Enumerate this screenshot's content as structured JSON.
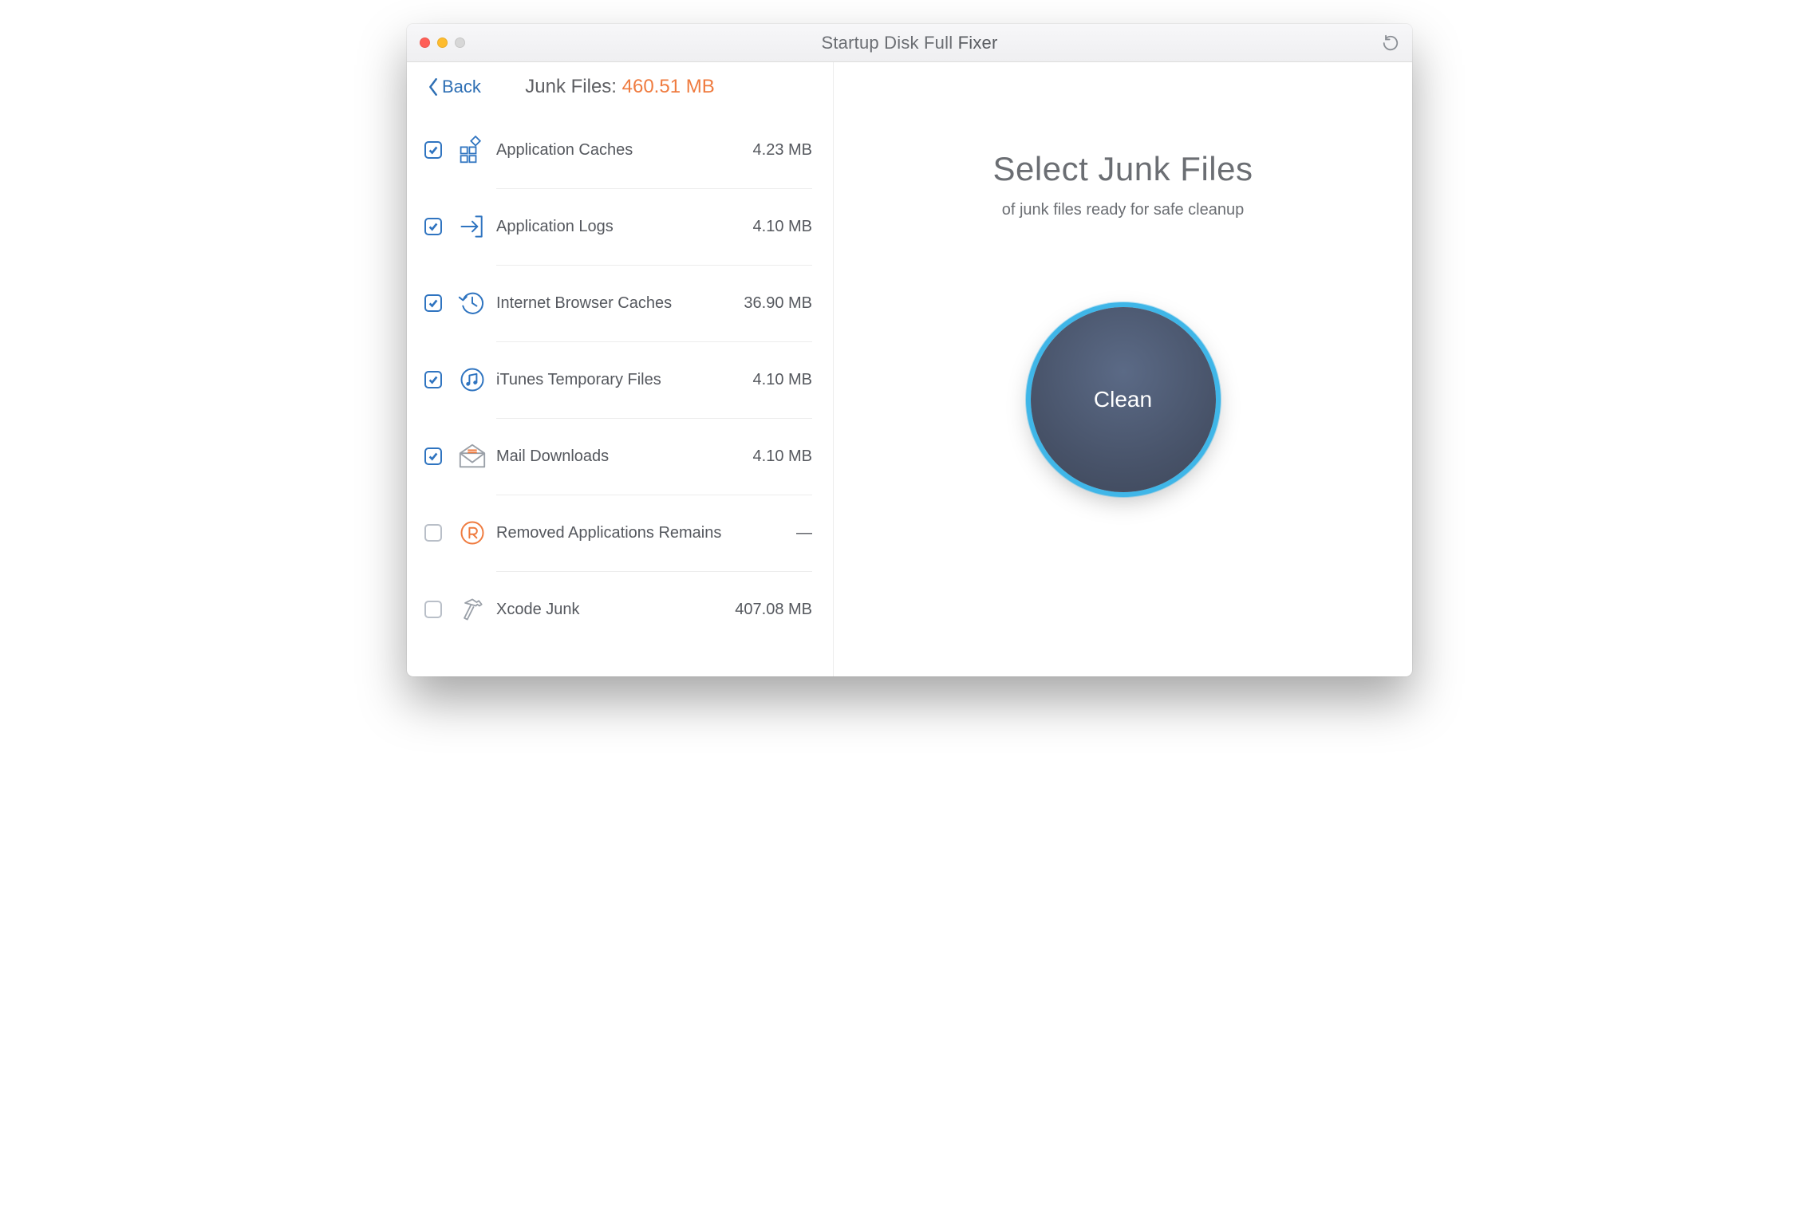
{
  "titlebar": {
    "app_name_light": "Startup Disk Full ",
    "app_name_bold": "Fixer"
  },
  "sidebar": {
    "back_label": "Back",
    "summary_label": "Junk Files: ",
    "summary_amount": "460.51 MB",
    "items": [
      {
        "label": "Application Caches",
        "size": "4.23 MB",
        "checked": true,
        "icon": "grid"
      },
      {
        "label": "Application Logs",
        "size": "4.10 MB",
        "checked": true,
        "icon": "arrow-in"
      },
      {
        "label": "Internet Browser Caches",
        "size": "36.90 MB",
        "checked": true,
        "icon": "history"
      },
      {
        "label": "iTunes Temporary Files",
        "size": "4.10 MB",
        "checked": true,
        "icon": "music"
      },
      {
        "label": "Mail Downloads",
        "size": "4.10 MB",
        "checked": true,
        "icon": "mail"
      },
      {
        "label": "Removed Applications Remains",
        "size": "—",
        "checked": false,
        "icon": "removed"
      },
      {
        "label": "Xcode Junk",
        "size": "407.08 MB",
        "checked": false,
        "icon": "hammer"
      }
    ]
  },
  "main": {
    "headline": "Select Junk Files",
    "sub": "of junk files ready for safe cleanup",
    "clean_label": "Clean"
  }
}
